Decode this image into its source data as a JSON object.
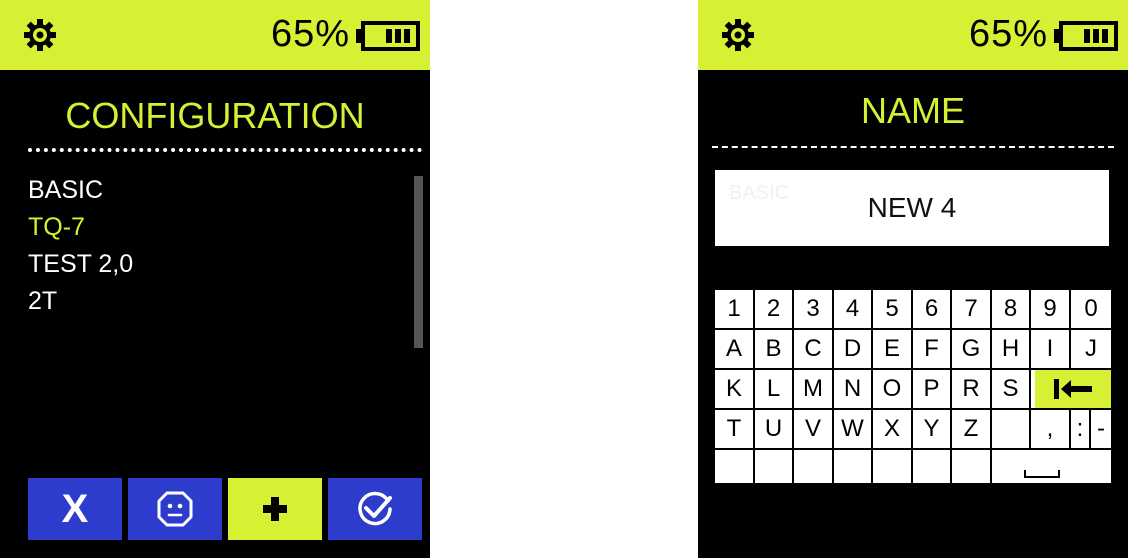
{
  "colors": {
    "accent": "#d7f034",
    "button_blue": "#2d3ccc",
    "background": "#000000"
  },
  "left_screen": {
    "status": {
      "battery_percent": "65%",
      "settings_icon": "gear-icon",
      "battery_icon": "battery-full-icon"
    },
    "title": "CONFIGURATION",
    "configurations": [
      {
        "label": "BASIC",
        "selected": false
      },
      {
        "label": "TQ-7",
        "selected": true
      },
      {
        "label": "TEST 2,0",
        "selected": false
      },
      {
        "label": "2T",
        "selected": false
      }
    ],
    "buttons": [
      {
        "name": "cancel-button",
        "label": "X",
        "icon": "close-icon"
      },
      {
        "name": "profile-button",
        "icon": "face-icon"
      },
      {
        "name": "add-button",
        "icon": "plus-icon"
      },
      {
        "name": "confirm-button",
        "icon": "check-circle-icon"
      }
    ]
  },
  "right_screen": {
    "status": {
      "battery_percent": "65%",
      "settings_icon": "gear-icon",
      "battery_icon": "battery-full-icon"
    },
    "title": "NAME",
    "name_field": {
      "ghost_text": "BASIC",
      "value": "NEW 4"
    },
    "keyboard": {
      "rows": [
        [
          "1",
          "2",
          "3",
          "4",
          "5",
          "6",
          "7",
          "8",
          "9",
          "0"
        ],
        [
          "A",
          "B",
          "C",
          "D",
          "E",
          "F",
          "G",
          "H",
          "I",
          "J"
        ],
        [
          "K",
          "L",
          "M",
          "N",
          "O",
          "P",
          "R",
          "S"
        ],
        [
          "T",
          "U",
          "V",
          "W",
          "X",
          "Y",
          "Z",
          "",
          ",",
          ":",
          "-"
        ]
      ],
      "backspace_icon": "backspace-icon",
      "space_icon": "space-icon"
    }
  }
}
